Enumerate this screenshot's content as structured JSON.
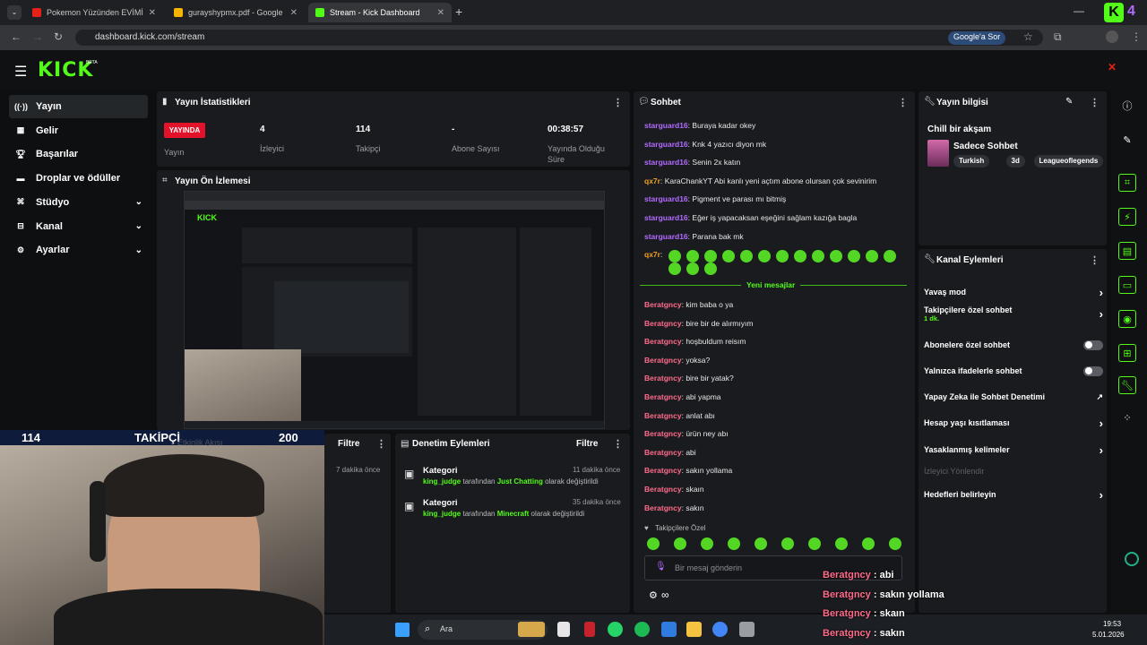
{
  "browser": {
    "tabs": [
      {
        "title": "Pokemon Yüzünden EVİMİ POL",
        "icon": "youtube-icon",
        "color": "#e62117"
      },
      {
        "title": "gurayshypmx.pdf - Google Driv",
        "icon": "drive-icon",
        "color": "#f4b400"
      },
      {
        "title": "Stream - Kick Dashboard",
        "icon": "kick-icon",
        "color": "#53fc18"
      }
    ],
    "url": "dashboard.kick.com/stream",
    "google_ask": "Google'a Sor"
  },
  "brand": {
    "logo": "KICK",
    "beta": "BETA",
    "accent": "#53fc18"
  },
  "sidebar": {
    "items": [
      {
        "label": "Yayın",
        "icon": "broadcast-icon",
        "active": true
      },
      {
        "label": "Gelir",
        "icon": "revenue-icon"
      },
      {
        "label": "Başarılar",
        "icon": "trophy-icon"
      },
      {
        "label": "Droplar ve ödüller",
        "icon": "gift-icon"
      },
      {
        "label": "Stüdyo",
        "icon": "studio-icon",
        "chevron": true
      },
      {
        "label": "Kanal",
        "icon": "channel-icon",
        "chevron": true
      },
      {
        "label": "Ayarlar",
        "icon": "settings-icon",
        "chevron": true
      }
    ]
  },
  "stats": {
    "title": "Yayın İstatistikleri",
    "live_badge": "YAYINDA",
    "live_label": "Yayın",
    "items": [
      {
        "value": "4",
        "label": "İzleyici"
      },
      {
        "value": "114",
        "label": "Takipçi"
      },
      {
        "value": "-",
        "label": "Abone Sayısı"
      },
      {
        "value": "00:38:57",
        "label": "Yayında Olduğu Süre"
      }
    ]
  },
  "preview": {
    "title": "Yayın Ön İzlemesi"
  },
  "follow_overlay": {
    "count": "114",
    "label": "TAKİPÇİ",
    "goal": "200",
    "partial": "Etkinlik Akışı"
  },
  "activity": {
    "filter": "Filtre",
    "time": "7 dakika önce"
  },
  "moderation": {
    "title": "Denetim Eylemleri",
    "filter": "Filtre",
    "entries": [
      {
        "type": "Kategori",
        "user": "king_judge",
        "text1": "tarafından",
        "category": "Just Chatting",
        "text2": "olarak değiştirildi",
        "time": "11 dakika önce"
      },
      {
        "type": "Kategori",
        "user": "king_judge",
        "text1": "tarafından",
        "category": "Minecraft",
        "text2": "olarak değiştirildi",
        "time": "35 dakika önce"
      }
    ]
  },
  "chat": {
    "title": "Sohbet",
    "messages_before": [
      {
        "user": "starguard16",
        "text": "Buraya kadar okey",
        "color": "#b36bff"
      },
      {
        "user": "starguard16",
        "text": "Knk 4 yazıcı diyon mk",
        "color": "#b36bff"
      },
      {
        "user": "starguard16",
        "text": "Senin 2x katın",
        "color": "#b36bff"
      },
      {
        "user": "qx7r",
        "text": "KaraChankYT Abi kanlı yeni açtım abone olursan çok sevinirim",
        "color": "#f0a020"
      },
      {
        "user": "starguard16",
        "text": "Pigment ve parası mı bitmiş",
        "color": "#b36bff"
      },
      {
        "user": "starguard16",
        "text": "Eğer iş yapacaksan eşeğini sağlam kazığa bagla",
        "color": "#b36bff"
      },
      {
        "user": "starguard16",
        "text": "Parana bak mk",
        "color": "#b36bff"
      },
      {
        "user": "qx7r",
        "text": "",
        "color": "#f0a020"
      }
    ],
    "new_messages": "Yeni mesajlar",
    "messages_after": [
      {
        "user": "Beratgncy",
        "text": "kim baba o ya"
      },
      {
        "user": "Beratgncy",
        "text": "bire bir de alırmıyım"
      },
      {
        "user": "Beratgncy",
        "text": "hoşbuldum reisım"
      },
      {
        "user": "Beratgncy",
        "text": "yoksa?"
      },
      {
        "user": "Beratgncy",
        "text": "bire bir yatak?"
      },
      {
        "user": "Beratgncy",
        "text": "abi yapma"
      },
      {
        "user": "Beratgncy",
        "text": "anlat abı"
      },
      {
        "user": "Beratgncy",
        "text": "ürün ney abı"
      },
      {
        "user": "Beratgncy",
        "text": "abi"
      },
      {
        "user": "Beratgncy",
        "text": "sakın yollama"
      },
      {
        "user": "Beratgncy",
        "text": "skaın"
      },
      {
        "user": "Beratgncy",
        "text": "sakın"
      }
    ],
    "followers_only": "Takipçilere Özel",
    "placeholder": "Bir mesaj gönderin",
    "user_color": "#ff6b8a"
  },
  "stream_info": {
    "title": "Yayın bilgisi",
    "stream_title": "Chill bir akşam",
    "category": "Sadece Sohbet",
    "tags": [
      "Turkish",
      "3d",
      "Leagueoflegends"
    ]
  },
  "channel_actions": {
    "title": "Kanal Eylemleri",
    "items": [
      {
        "label": "Yavaş mod",
        "control": "arrow"
      },
      {
        "label": "Takipçilere özel sohbet",
        "sub": "1 dk.",
        "control": "arrow"
      },
      {
        "label": "Abonelere özel sohbet",
        "control": "toggle"
      },
      {
        "label": "Yalnızca ifadelerle sohbet",
        "control": "toggle"
      },
      {
        "label": "Yapay Zeka ile Sohbet Denetimi",
        "control": "external"
      },
      {
        "label": "Hesap yaşı kısıtlaması",
        "control": "arrow"
      },
      {
        "label": "Yasaklanmış kelimeler",
        "control": "arrow"
      },
      {
        "label": "İzleyici Yönlendir",
        "control": "none",
        "disabled": true
      },
      {
        "label": "Hedefleri belirleyin",
        "control": "arrow"
      }
    ]
  },
  "overlay_chat": [
    {
      "user": "Beratgncy",
      "text": "abi"
    },
    {
      "user": "Beratgncy",
      "text": "sakın yollama"
    },
    {
      "user": "Beratgncy",
      "text": "skaın"
    },
    {
      "user": "Beratgncy",
      "text": "sakın"
    }
  ],
  "taskbar": {
    "search": "Ara",
    "time": "19:53",
    "date": "5.01.2026"
  }
}
